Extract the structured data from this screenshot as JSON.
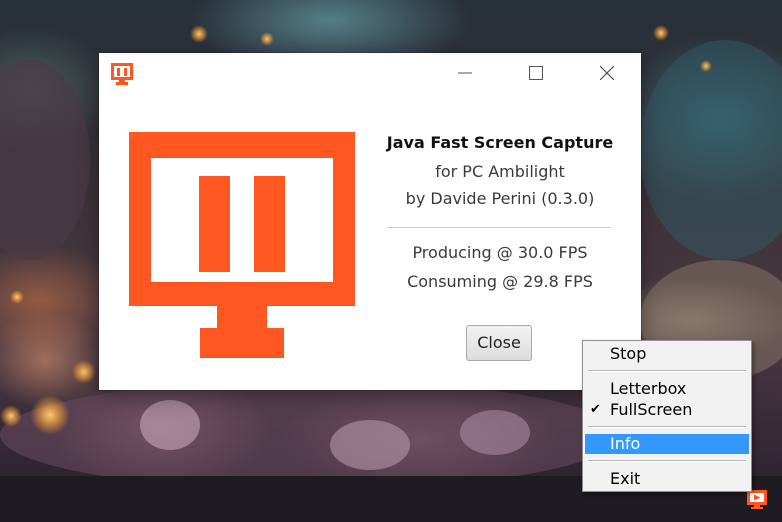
{
  "dialog": {
    "app_name": "Java Fast Screen Capture",
    "subtitle": "for PC Ambilight",
    "author": "by Davide Perini (0.3.0)",
    "producing": "Producing @ 30.0 FPS",
    "consuming": "Consuming @ 29.8 FPS",
    "close_label": "Close",
    "title_icon": "app-logo-icon",
    "logo_icon": "app-logo-icon"
  },
  "window_controls": [
    "minimize-icon",
    "maximize-icon",
    "close-icon"
  ],
  "tray_menu": {
    "items": [
      {
        "label": "Stop"
      },
      {
        "label": "Letterbox"
      },
      {
        "label": "FullScreen",
        "checked": true
      },
      {
        "label": "Info",
        "highlighted": true
      },
      {
        "label": "Exit"
      }
    ]
  },
  "colors": {
    "brand_orange": "#ff5722",
    "menu_highlight": "#3399ff",
    "taskbar": "#1e1b21"
  }
}
